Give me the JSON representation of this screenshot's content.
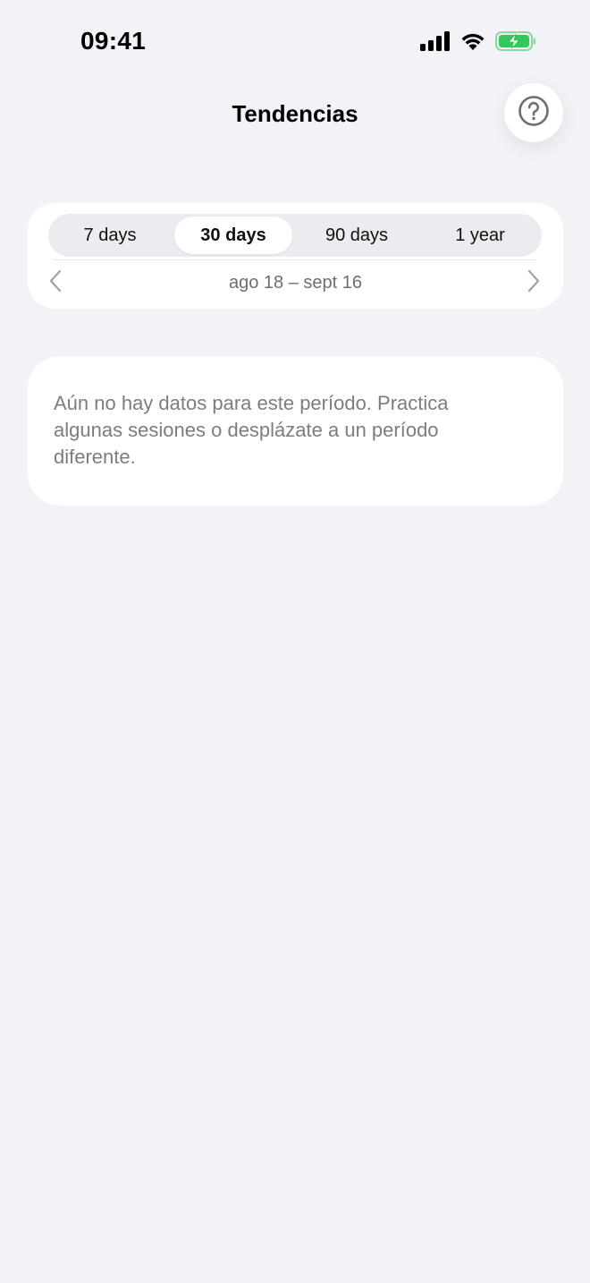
{
  "status_bar": {
    "time": "09:41",
    "icons": [
      "cellular-signal-icon",
      "wifi-icon",
      "battery-charging-icon"
    ],
    "battery_color": "#34c759"
  },
  "header": {
    "title": "Tendencias",
    "help_icon": "question-mark-circle-icon"
  },
  "period_selector": {
    "options": [
      {
        "label": "7 days",
        "selected": false
      },
      {
        "label": "30 days",
        "selected": true
      },
      {
        "label": "90 days",
        "selected": false
      },
      {
        "label": "1 year",
        "selected": false
      }
    ],
    "date_range": "ago 18 – sept 16",
    "prev_icon": "chevron-left-icon",
    "next_icon": "chevron-right-icon"
  },
  "empty_state": {
    "message": "Aún no hay datos para este período. Practica algunas sesiones o desplázate a un período diferente."
  },
  "colors": {
    "background": "#f2f2f7",
    "card": "#ffffff",
    "secondary_text": "#7c7c81"
  }
}
